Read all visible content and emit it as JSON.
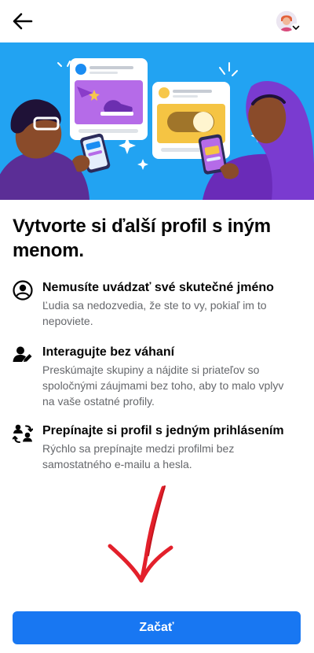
{
  "header": {
    "back_icon": "arrow-left-icon",
    "avatar_icon": "user-avatar",
    "switch_icon": "chevron-down-icon"
  },
  "hero": {
    "background": "#22a3f2",
    "illustration": "two people with phones and profile cards"
  },
  "title": "Vytvorte si ďalší profil s iným menom.",
  "features": [
    {
      "icon": "anonymous-user-icon",
      "title": "Nemusíte uvádzať své skutečné jméno",
      "description": "Ľudia sa nedozvedia, že ste to vy, pokiaľ im to nepoviete."
    },
    {
      "icon": "user-pencil-icon",
      "title": "Interagujte bez váhaní",
      "description": "Preskúmajte skupiny a nájdite si priateľov so spoločnými záujmami bez toho, aby to malo vplyv na vaše ostatné profily."
    },
    {
      "icon": "switch-users-icon",
      "title": "Prepínajte si profil s jedným prihlásením",
      "description": "Rýchlo sa prepínajte medzi profilmi bez samostatného e-mailu a hesla."
    }
  ],
  "annotation": {
    "color": "#e3202b"
  },
  "cta": {
    "label": "Začať",
    "color": "#1877f2"
  }
}
